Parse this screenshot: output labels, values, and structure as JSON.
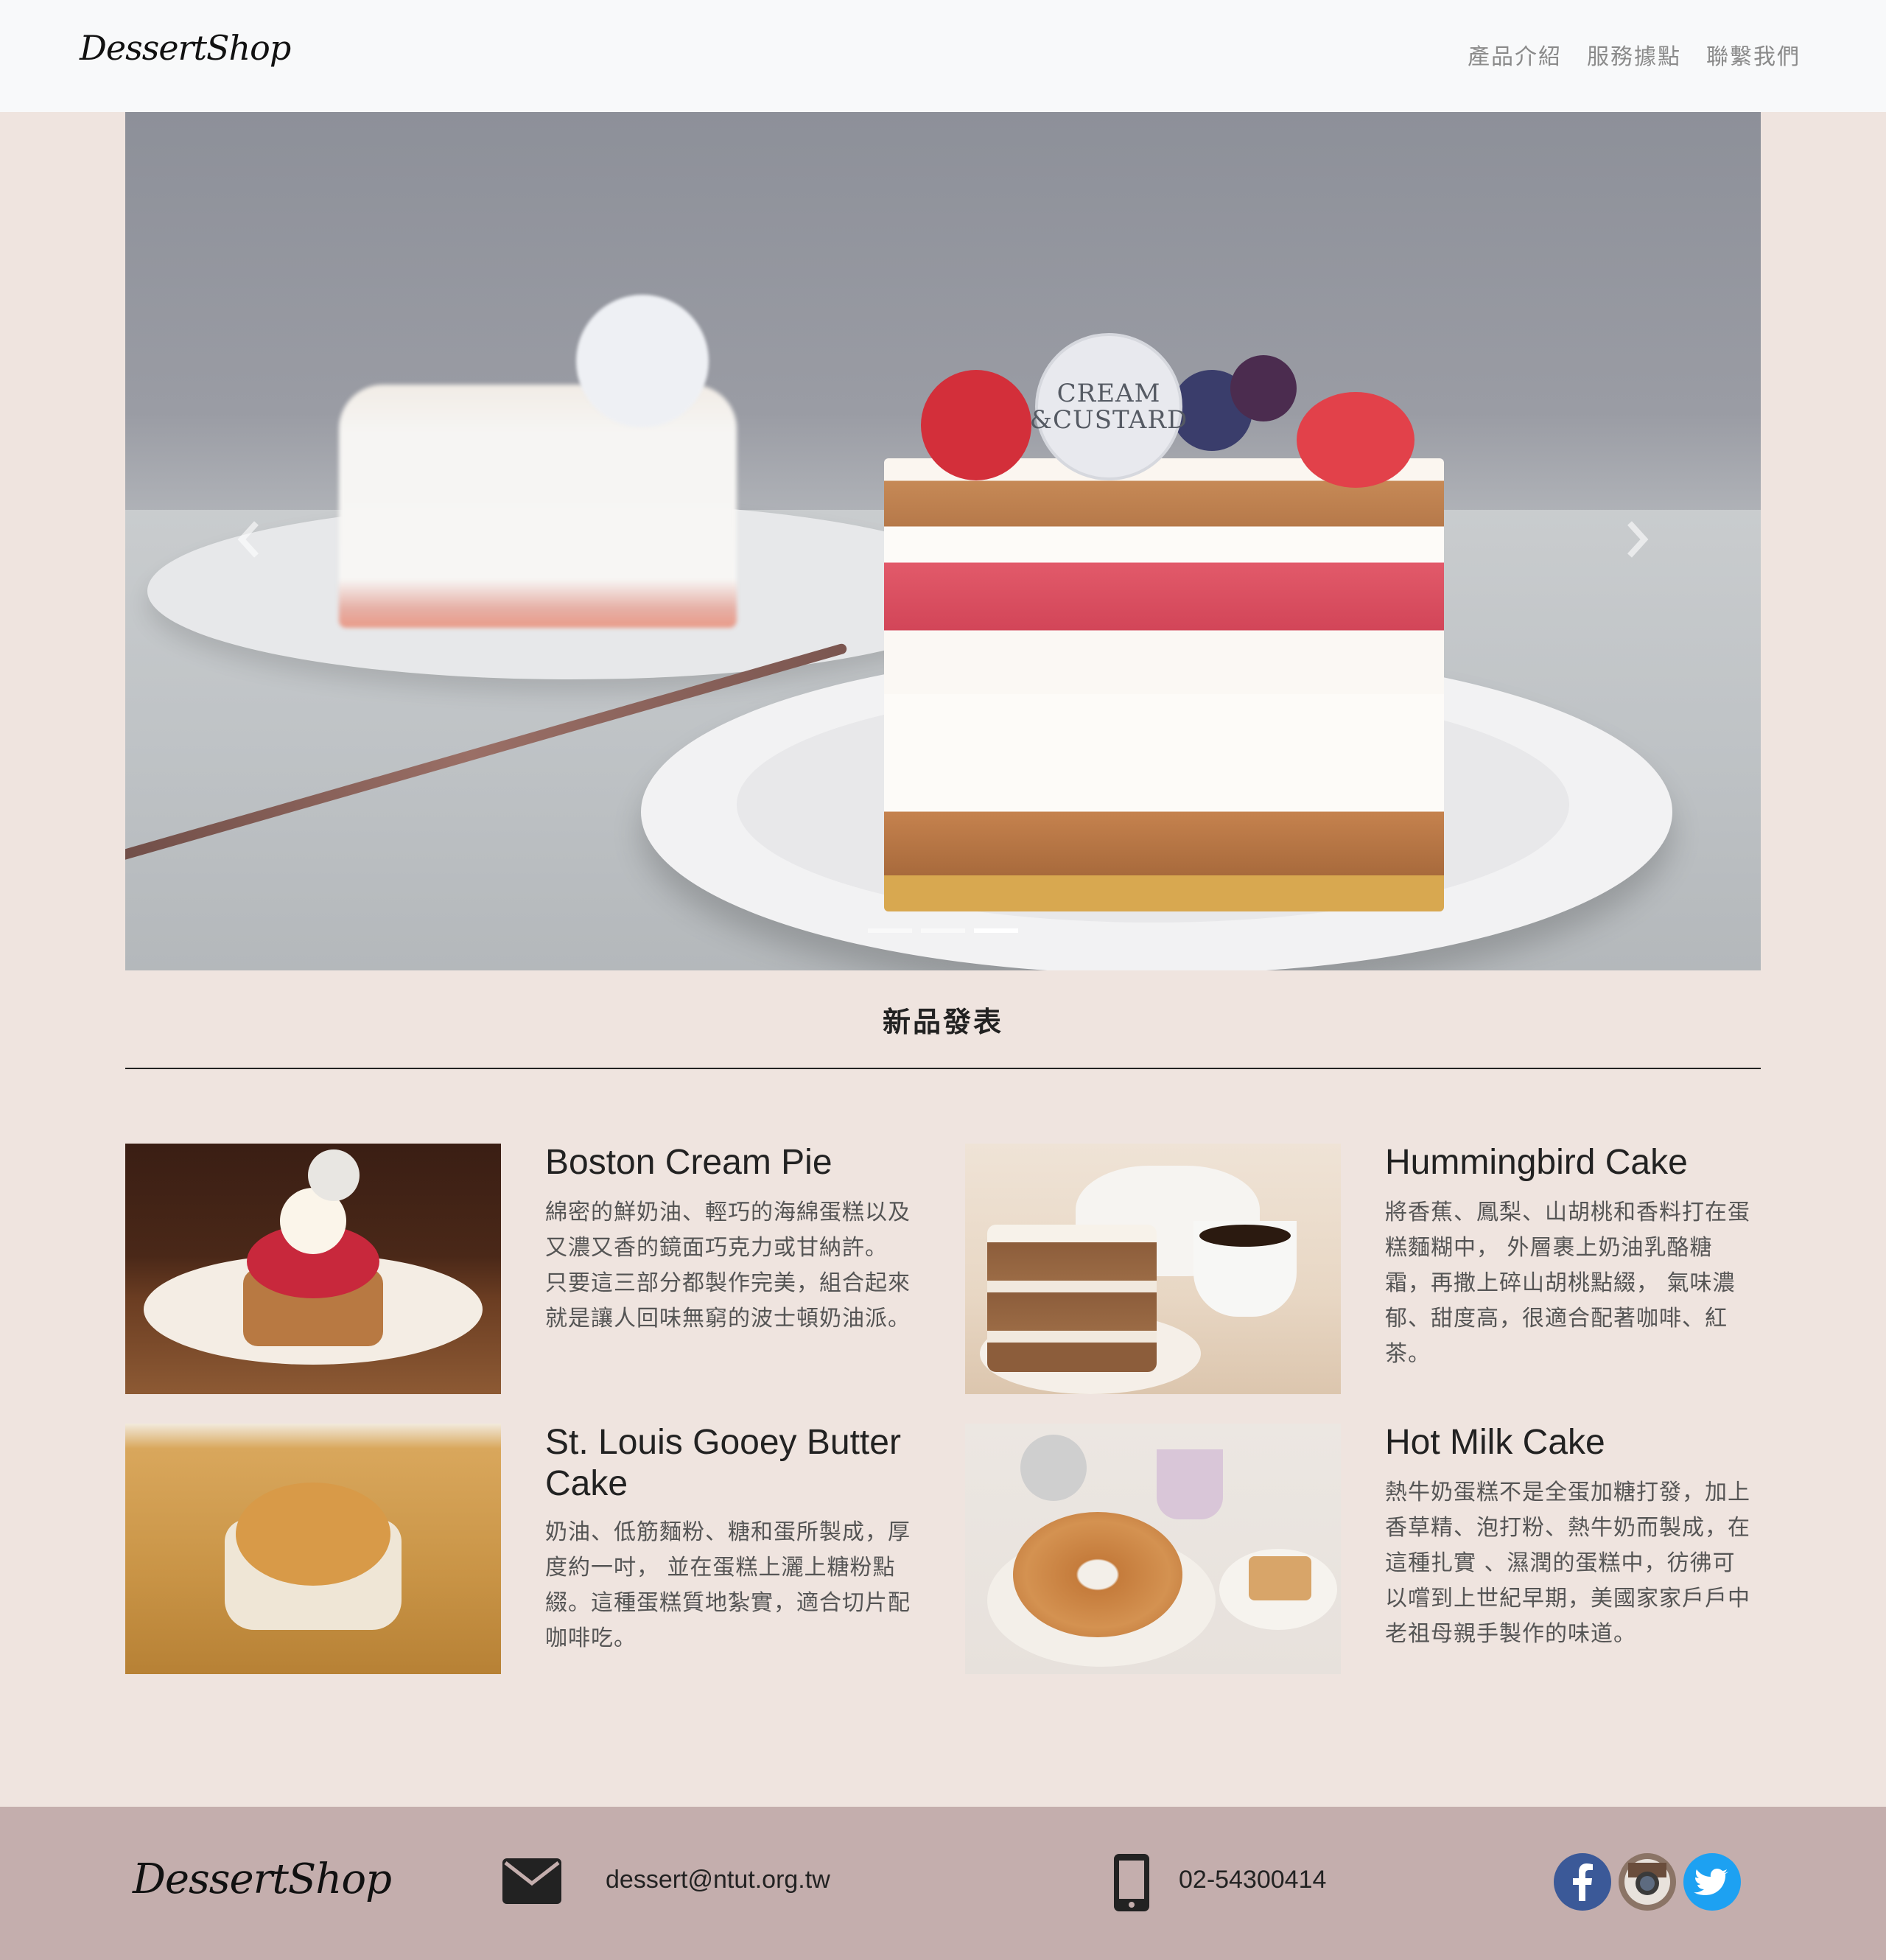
{
  "navbar": {
    "logo": "DessertShop",
    "links": [
      "產品介紹",
      "服務據點",
      "聯繫我們"
    ]
  },
  "carousel": {
    "tag_text": "CREAM &CUSTARD",
    "slide_count": 3,
    "active_slide": 3
  },
  "section": {
    "title": "新品發表"
  },
  "products": [
    {
      "name": "Boston Cream Pie",
      "desc": "綿密的鮮奶油、輕巧的海綿蛋糕以及又濃又香的鏡面巧克力或甘納許。 只要這三部分都製作完美，組合起來就是讓人回味無窮的波士頓奶油派。"
    },
    {
      "name": "Hummingbird Cake",
      "desc": "將香蕉、鳳梨、山胡桃和香料打在蛋糕麵糊中， 外層裹上奶油乳酪糖霜，再撒上碎山胡桃點綴， 氣味濃郁、甜度高，很適合配著咖啡、紅茶。"
    },
    {
      "name": "St. Louis Gooey Butter Cake",
      "desc": "奶油、低筋麵粉、糖和蛋所製成，厚度約一吋， 並在蛋糕上灑上糖粉點綴。這種蛋糕質地紮實，適合切片配咖啡吃。"
    },
    {
      "name": "Hot Milk Cake",
      "desc": "熱牛奶蛋糕不是全蛋加糖打發，加上香草精、泡打粉、熱牛奶而製成，在這種扎實 、濕潤的蛋糕中，彷彿可以嚐到上世紀早期，美國家家戶戶中老祖母親手製作的味道。"
    }
  ],
  "footer": {
    "logo": "DessertShop",
    "email": "dessert@ntut.org.tw",
    "phone": "02-54300414",
    "social": [
      "facebook-icon",
      "instagram-icon",
      "twitter-icon"
    ]
  },
  "colors": {
    "page_bg": "#efe4df",
    "navbar_bg": "#f8f9fa",
    "footer_bg": "#c4aead",
    "facebook": "#3b5998",
    "twitter": "#1da1f2"
  }
}
